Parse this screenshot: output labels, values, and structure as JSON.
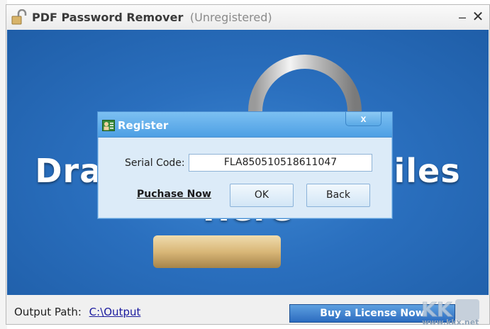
{
  "window": {
    "title": "PDF Password Remover",
    "title_status": "(Unregistered)",
    "minimize_glyph": "–",
    "close_glyph": "✕"
  },
  "drop_area": {
    "text": "Drag & Drop PDF Files Here"
  },
  "bottom": {
    "output_label": "Output Path:",
    "output_path": "C:\\Output",
    "buy_label": "Buy a License Now"
  },
  "register_dialog": {
    "title": "Register",
    "close_glyph": "x",
    "serial_label": "Serial Code:",
    "serial_value": "FLA850510518611047",
    "purchase_label": "Puchase Now",
    "ok_label": "OK",
    "back_label": "Back"
  },
  "watermark": {
    "text": "www.kkx.net"
  },
  "icons": {
    "app": "lock-icon",
    "dialog": "user-card-icon"
  },
  "colors": {
    "accent_blue": "#2a6fbe",
    "dialog_title": "#4d9fe4",
    "link": "#1a1a9e"
  }
}
